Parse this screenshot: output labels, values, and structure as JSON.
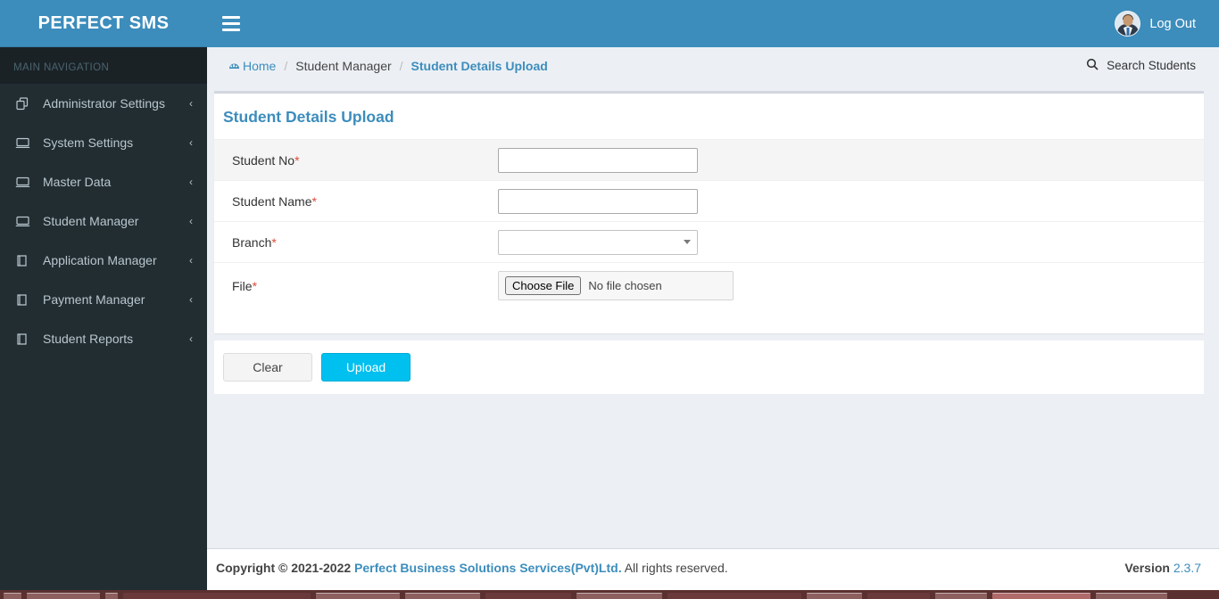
{
  "brand": {
    "title": "PERFECT SMS"
  },
  "sidebar": {
    "nav_header": "MAIN NAVIGATION",
    "items": [
      {
        "label": "Administrator Settings",
        "icon": "copy-icon",
        "arrow": "‹"
      },
      {
        "label": "System Settings",
        "icon": "monitor-icon",
        "arrow": "‹"
      },
      {
        "label": "Master Data",
        "icon": "monitor-icon",
        "arrow": "‹"
      },
      {
        "label": "Student Manager",
        "icon": "monitor-icon",
        "arrow": "‹"
      },
      {
        "label": "Application Manager",
        "icon": "book-icon",
        "arrow": "‹"
      },
      {
        "label": "Payment Manager",
        "icon": "book-icon",
        "arrow": "‹"
      },
      {
        "label": "Student Reports",
        "icon": "book-icon",
        "arrow": "‹"
      }
    ]
  },
  "topbar": {
    "menu_toggle_icon": "hamburger-icon",
    "avatar_icon": "user-avatar",
    "logout_label": "Log Out"
  },
  "breadcrumb": {
    "home_label": "Home",
    "home_icon": "dashboard-icon",
    "separator": "/",
    "parent_label": "Student Manager",
    "current_label": "Student Details Upload",
    "search_icon": "search-icon",
    "search_label": "Search Students"
  },
  "panel": {
    "title": "Student Details Upload",
    "rows": [
      {
        "label": "Student No",
        "required": "*",
        "control": "text",
        "value": "",
        "placeholder": ""
      },
      {
        "label": "Student Name",
        "required": "*",
        "control": "text",
        "value": "",
        "placeholder": ""
      },
      {
        "label": "Branch",
        "required": "*",
        "control": "select",
        "value": "",
        "options": []
      },
      {
        "label": "File",
        "required": "*",
        "control": "file",
        "button_label": "Choose File",
        "file_status": "No file chosen"
      }
    ]
  },
  "actions": {
    "clear_label": "Clear",
    "upload_label": "Upload"
  },
  "footer": {
    "copyright_prefix": "Copyright © 2021-2022",
    "company": "Perfect Business Solutions Services(Pvt)Ltd.",
    "rights": "All rights reserved.",
    "version_label": "Version",
    "version_number": "2.3.7"
  },
  "colors": {
    "brand_blue": "#3c8dbc",
    "sidebar_dark": "#222d32",
    "accent_cyan": "#00c0ef",
    "required_red": "#dd4b39",
    "body_bg": "#ecf0f5"
  }
}
